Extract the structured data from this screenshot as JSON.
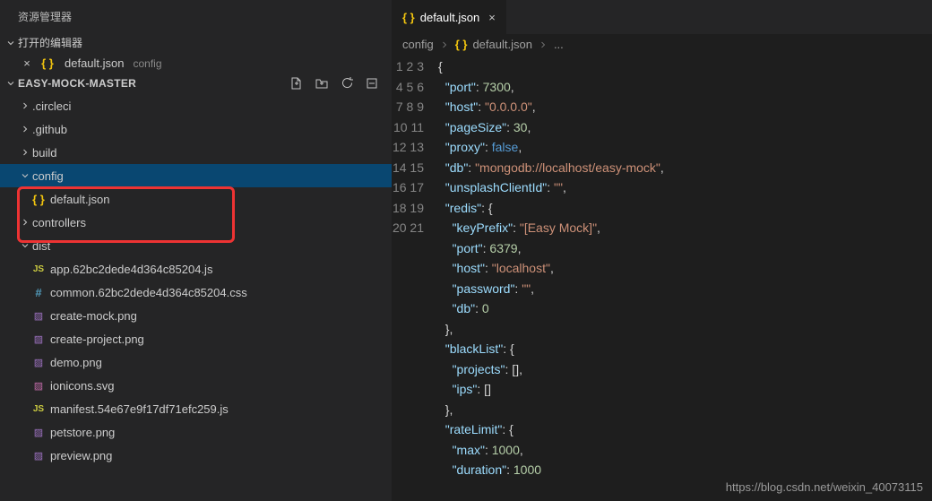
{
  "sidebar": {
    "title": "资源管理器",
    "openEditors": {
      "label": "打开的编辑器",
      "items": [
        {
          "name": "default.json",
          "path": "config"
        }
      ]
    },
    "project": "EASY-MOCK-MASTER",
    "tree": [
      {
        "kind": "folder",
        "name": ".circleci",
        "depth": 0,
        "open": false
      },
      {
        "kind": "folder",
        "name": ".github",
        "depth": 0,
        "open": false
      },
      {
        "kind": "folder",
        "name": "build",
        "depth": 0,
        "open": false
      },
      {
        "kind": "folder",
        "name": "config",
        "depth": 0,
        "open": true,
        "selected": true
      },
      {
        "kind": "file",
        "name": "default.json",
        "depth": 1,
        "ico": "braces"
      },
      {
        "kind": "folder",
        "name": "controllers",
        "depth": 0,
        "open": false
      },
      {
        "kind": "folder",
        "name": "dist",
        "depth": 0,
        "open": true
      },
      {
        "kind": "file",
        "name": "app.62bc2dede4d364c85204.js",
        "depth": 1,
        "ico": "js"
      },
      {
        "kind": "file",
        "name": "common.62bc2dede4d364c85204.css",
        "depth": 1,
        "ico": "hash"
      },
      {
        "kind": "file",
        "name": "create-mock.png",
        "depth": 1,
        "ico": "img"
      },
      {
        "kind": "file",
        "name": "create-project.png",
        "depth": 1,
        "ico": "img"
      },
      {
        "kind": "file",
        "name": "demo.png",
        "depth": 1,
        "ico": "img"
      },
      {
        "kind": "file",
        "name": "ionicons.svg",
        "depth": 1,
        "ico": "svg"
      },
      {
        "kind": "file",
        "name": "manifest.54e67e9f17df71efc259.js",
        "depth": 1,
        "ico": "js"
      },
      {
        "kind": "file",
        "name": "petstore.png",
        "depth": 1,
        "ico": "img"
      },
      {
        "kind": "file",
        "name": "preview.png",
        "depth": 1,
        "ico": "img"
      }
    ]
  },
  "editor": {
    "tab": {
      "name": "default.json"
    },
    "breadcrumb": [
      "config",
      "default.json",
      "..."
    ],
    "lines": [
      [
        [
          "pun",
          "{"
        ]
      ],
      [
        [
          "pun",
          "  "
        ],
        [
          "key",
          "\"port\""
        ],
        [
          "pun",
          ": "
        ],
        [
          "num",
          "7300"
        ],
        [
          "pun",
          ","
        ]
      ],
      [
        [
          "pun",
          "  "
        ],
        [
          "key",
          "\"host\""
        ],
        [
          "pun",
          ": "
        ],
        [
          "str",
          "\"0.0.0.0\""
        ],
        [
          "pun",
          ","
        ]
      ],
      [
        [
          "pun",
          "  "
        ],
        [
          "key",
          "\"pageSize\""
        ],
        [
          "pun",
          ": "
        ],
        [
          "num",
          "30"
        ],
        [
          "pun",
          ","
        ]
      ],
      [
        [
          "pun",
          "  "
        ],
        [
          "key",
          "\"proxy\""
        ],
        [
          "pun",
          ": "
        ],
        [
          "kw",
          "false"
        ],
        [
          "pun",
          ","
        ]
      ],
      [
        [
          "pun",
          "  "
        ],
        [
          "key",
          "\"db\""
        ],
        [
          "pun",
          ": "
        ],
        [
          "str",
          "\"mongodb://localhost/easy-mock\""
        ],
        [
          "pun",
          ","
        ]
      ],
      [
        [
          "pun",
          "  "
        ],
        [
          "key",
          "\"unsplashClientId\""
        ],
        [
          "pun",
          ": "
        ],
        [
          "str",
          "\"\""
        ],
        [
          "pun",
          ","
        ]
      ],
      [
        [
          "pun",
          "  "
        ],
        [
          "key",
          "\"redis\""
        ],
        [
          "pun",
          ": {"
        ]
      ],
      [
        [
          "pun",
          "    "
        ],
        [
          "key",
          "\"keyPrefix\""
        ],
        [
          "pun",
          ": "
        ],
        [
          "str",
          "\"[Easy Mock]\""
        ],
        [
          "pun",
          ","
        ]
      ],
      [
        [
          "pun",
          "    "
        ],
        [
          "key",
          "\"port\""
        ],
        [
          "pun",
          ": "
        ],
        [
          "num",
          "6379"
        ],
        [
          "pun",
          ","
        ]
      ],
      [
        [
          "pun",
          "    "
        ],
        [
          "key",
          "\"host\""
        ],
        [
          "pun",
          ": "
        ],
        [
          "str",
          "\"localhost\""
        ],
        [
          "pun",
          ","
        ]
      ],
      [
        [
          "pun",
          "    "
        ],
        [
          "key",
          "\"password\""
        ],
        [
          "pun",
          ": "
        ],
        [
          "str",
          "\"\""
        ],
        [
          "pun",
          ","
        ]
      ],
      [
        [
          "pun",
          "    "
        ],
        [
          "key",
          "\"db\""
        ],
        [
          "pun",
          ": "
        ],
        [
          "num",
          "0"
        ]
      ],
      [
        [
          "pun",
          "  },"
        ]
      ],
      [
        [
          "pun",
          "  "
        ],
        [
          "key",
          "\"blackList\""
        ],
        [
          "pun",
          ": {"
        ]
      ],
      [
        [
          "pun",
          "    "
        ],
        [
          "key",
          "\"projects\""
        ],
        [
          "pun",
          ": [],"
        ]
      ],
      [
        [
          "pun",
          "    "
        ],
        [
          "key",
          "\"ips\""
        ],
        [
          "pun",
          ": []"
        ]
      ],
      [
        [
          "pun",
          "  },"
        ]
      ],
      [
        [
          "pun",
          "  "
        ],
        [
          "key",
          "\"rateLimit\""
        ],
        [
          "pun",
          ": {"
        ]
      ],
      [
        [
          "pun",
          "    "
        ],
        [
          "key",
          "\"max\""
        ],
        [
          "pun",
          ": "
        ],
        [
          "num",
          "1000"
        ],
        [
          "pun",
          ","
        ]
      ],
      [
        [
          "pun",
          "    "
        ],
        [
          "key",
          "\"duration\""
        ],
        [
          "pun",
          ": "
        ],
        [
          "num",
          "1000"
        ]
      ]
    ]
  },
  "watermark": "https://blog.csdn.net/weixin_40073115"
}
